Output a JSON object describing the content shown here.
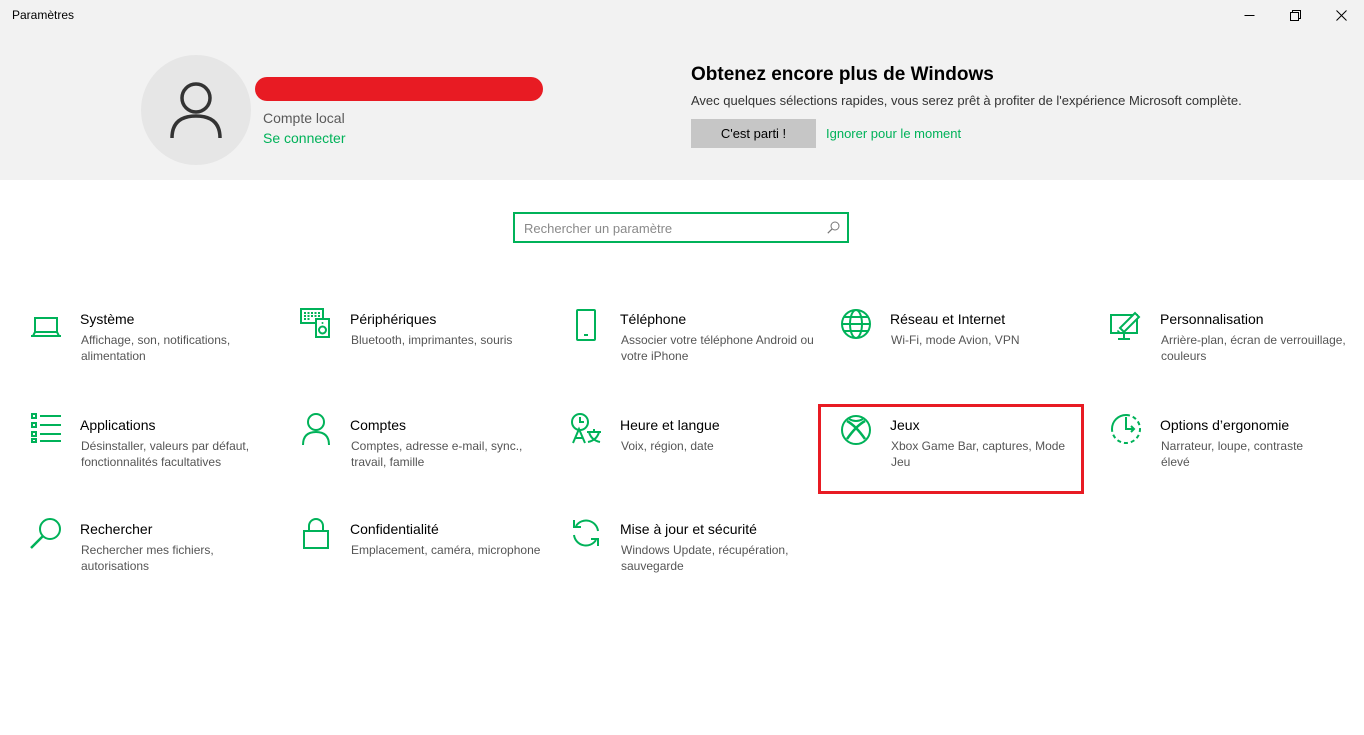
{
  "window": {
    "title": "Paramètres"
  },
  "account": {
    "type": "Compte local",
    "sign_in": "Se connecter"
  },
  "promo": {
    "title": "Obtenez encore plus de Windows",
    "description": "Avec quelques sélections rapides, vous serez prêt à profiter de l'expérience Microsoft complète.",
    "primary_button": "C'est parti !",
    "skip_link": "Ignorer pour le moment"
  },
  "search": {
    "placeholder": "Rechercher un paramètre"
  },
  "accent_color": "#00b259",
  "highlight_color": "#e81b23",
  "categories": [
    {
      "icon": "laptop-icon",
      "title": "Système",
      "desc": "Affichage, son, notifications, alimentation"
    },
    {
      "icon": "keyboard-speaker-icon",
      "title": "Périphériques",
      "desc": "Bluetooth, imprimantes, souris"
    },
    {
      "icon": "phone-icon",
      "title": "Téléphone",
      "desc": "Associer votre téléphone Android ou votre iPhone"
    },
    {
      "icon": "globe-icon",
      "title": "Réseau et Internet",
      "desc": "Wi-Fi, mode Avion, VPN"
    },
    {
      "icon": "paint-screen-icon",
      "title": "Personnalisation",
      "desc": "Arrière-plan, écran de verrouillage, couleurs"
    },
    {
      "icon": "apps-list-icon",
      "title": "Applications",
      "desc": "Désinstaller, valeurs par défaut, fonctionnalités facultatives"
    },
    {
      "icon": "person-icon",
      "title": "Comptes",
      "desc": "Comptes, adresse e-mail, sync., travail, famille"
    },
    {
      "icon": "time-language-icon",
      "title": "Heure et langue",
      "desc": "Voix, région, date"
    },
    {
      "icon": "xbox-icon",
      "title": "Jeux",
      "desc": "Xbox Game Bar, captures, Mode Jeu"
    },
    {
      "icon": "ease-of-access-icon",
      "title": "Options d’ergonomie",
      "desc": "Narrateur, loupe, contraste élevé"
    },
    {
      "icon": "search-icon",
      "title": "Rechercher",
      "desc": "Rechercher mes fichiers, autorisations"
    },
    {
      "icon": "lock-icon",
      "title": "Confidentialité",
      "desc": "Emplacement, caméra, microphone"
    },
    {
      "icon": "update-icon",
      "title": "Mise à jour et sécurité",
      "desc": "Windows Update, récupération, sauvegarde"
    }
  ]
}
